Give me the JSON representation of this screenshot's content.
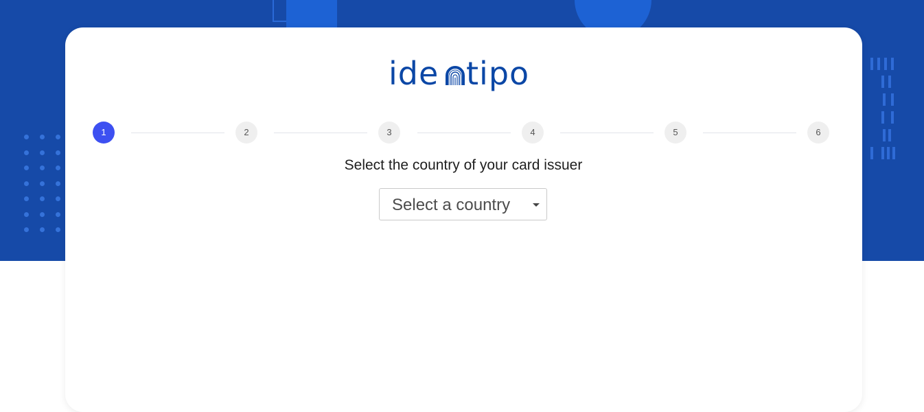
{
  "brand": {
    "logo_text": "identipo",
    "logo_icon": "fingerprint-icon",
    "color": "#0b47a6"
  },
  "colors": {
    "hero_background": "#164aa8",
    "active_step": "#3d50f1",
    "inactive_step": "#efefef"
  },
  "stepper": {
    "steps": [
      "1",
      "2",
      "3",
      "4",
      "5",
      "6"
    ],
    "active": 1
  },
  "form": {
    "prompt": "Select the country of your card issuer",
    "country_select": {
      "selected_label": "Select a country",
      "icon": "caret-down-icon"
    }
  }
}
